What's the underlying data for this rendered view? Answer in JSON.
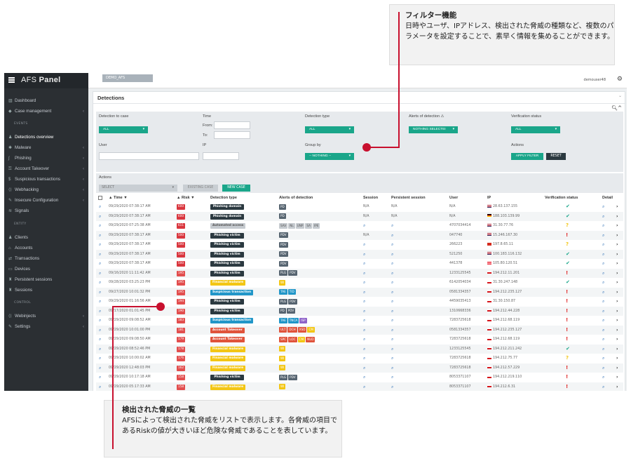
{
  "app": {
    "brand_light": "AFS ",
    "brand_bold": "Panel",
    "env": "DEMO_AFS",
    "user": "demouser48"
  },
  "sidebar": {
    "items": [
      {
        "label": "Dashboard",
        "icon": "bar-chart-icon",
        "chev": ""
      },
      {
        "label": "Case management",
        "icon": "tag-icon",
        "chev": "‹"
      },
      {
        "label": "Detections overview",
        "icon": "users-icon",
        "chev": ""
      },
      {
        "label": "Malware",
        "icon": "bug-icon",
        "chev": "‹"
      },
      {
        "label": "Phishing",
        "icon": "phishing-icon",
        "chev": "‹"
      },
      {
        "label": "Account Takeover",
        "icon": "key-icon",
        "chev": "‹"
      },
      {
        "label": "Suspicious transactions",
        "icon": "dollar-icon",
        "chev": "‹"
      },
      {
        "label": "Webhacking",
        "icon": "code-icon",
        "chev": "‹"
      },
      {
        "label": "Insecure Configuration",
        "icon": "wrench-icon",
        "chev": "‹"
      },
      {
        "label": "Signals",
        "icon": "signal-icon",
        "chev": ""
      },
      {
        "label": "Clients",
        "icon": "user-icon",
        "chev": ""
      },
      {
        "label": "Accounts",
        "icon": "bank-icon",
        "chev": ""
      },
      {
        "label": "Transactions",
        "icon": "exchange-icon",
        "chev": ""
      },
      {
        "label": "Devices",
        "icon": "monitor-icon",
        "chev": ""
      },
      {
        "label": "Persistent sessions",
        "icon": "person-icon",
        "chev": ""
      },
      {
        "label": "Sessions",
        "icon": "person-icon",
        "chev": ""
      },
      {
        "label": "Webinjects",
        "icon": "code-icon",
        "chev": "‹"
      },
      {
        "label": "Settings",
        "icon": "wrench-icon",
        "chev": "‹"
      }
    ],
    "sections": {
      "events": "EVENTS",
      "entity": "ENTITY",
      "control": "CONTROL"
    }
  },
  "content": {
    "title": "Detections"
  },
  "filters": {
    "detection_to_case": "Detection to case",
    "detection_to_case_value": "ALL",
    "time": "Time",
    "from": "From:",
    "to": "To:",
    "detection_type": "Detection type",
    "detection_type_value": "ALL",
    "alerts_of_detection": "Alerts of detection ⚠",
    "alerts_value": "NOTHING SELECTEI",
    "verification_status": "Verification status",
    "verification_value": "ALL",
    "user": "User",
    "ip": "IP",
    "group_by": "Group by",
    "group_by_value": "-- NOTHING --",
    "actions": "Actions",
    "apply_filter": "APPLY FILTER",
    "reset": "RESET"
  },
  "actions": {
    "title": "Actions",
    "select": "SELECT",
    "existing_case": "EXISTING CASE",
    "new_case": "NEW CASE"
  },
  "table": {
    "headers": {
      "time": "▲ Time ▼",
      "risk": "▲ Risk ▼",
      "type": "Detection type",
      "alerts": "Alerts of detection",
      "session": "Session",
      "psession": "Persistent session",
      "user": "User",
      "ip": "IP",
      "verif": "Verification status",
      "detail": "Detail"
    },
    "rows": [
      {
        "time": "09/29/2020 07:38:17 AM",
        "risk": "600",
        "type": "Phishing domain",
        "tc": "#2b3940",
        "alerts": [
          [
            "PD",
            "#566470"
          ]
        ],
        "session": "N/A",
        "ps": "N/A",
        "user": "N/A",
        "flag": "us",
        "ip": "28.63.137.155",
        "v": "ok"
      },
      {
        "time": "09/29/2020 07:38:17 AM",
        "risk": "600",
        "type": "Phishing domain",
        "tc": "#2b3940",
        "alerts": [
          [
            "PD",
            "#566470"
          ]
        ],
        "session": "N/A",
        "ps": "N/A",
        "user": "N/A",
        "flag": "de",
        "ip": "188.103.139.99",
        "v": "ok"
      },
      {
        "time": "09/29/2020 07:25:38 AM",
        "risk": "611",
        "type": "Automated access",
        "tc": "#c5cacf",
        "alerts": [
          [
            "SAV",
            "#c5cacf"
          ],
          [
            "NL",
            "#c5cacf"
          ],
          [
            "UNP",
            "#c5cacf"
          ],
          [
            "SA",
            "#c5cacf"
          ],
          [
            "IPE",
            "#c5cacf"
          ]
        ],
        "session": "",
        "ps": "",
        "user": "4707034414",
        "flag": "us",
        "ip": "31.30.77.76",
        "v": "q"
      },
      {
        "time": "09/29/2020 07:38:17 AM",
        "risk": "500",
        "type": "Phishing victim",
        "tc": "#2b3940",
        "alerts": [
          [
            "PDV",
            "#566470"
          ]
        ],
        "session": "N/A",
        "ps": "",
        "user": "047740",
        "flag": "us",
        "ip": "15.246.167.30",
        "v": "x"
      },
      {
        "time": "09/29/2020 07:38:17 AM",
        "risk": "500",
        "type": "Phishing victim",
        "tc": "#2b3940",
        "alerts": [
          [
            "PDV",
            "#566470"
          ]
        ],
        "session": "",
        "ps": "",
        "user": "266223",
        "flag": "ch",
        "ip": "197.8.65.11",
        "v": "q"
      },
      {
        "time": "09/29/2020 07:38:17 AM",
        "risk": "500",
        "type": "Phishing victim",
        "tc": "#2b3940",
        "alerts": [
          [
            "PDV",
            "#566470"
          ]
        ],
        "session": "",
        "ps": "",
        "user": "521250",
        "flag": "us",
        "ip": "100.183.116.132",
        "v": "ok"
      },
      {
        "time": "09/29/2020 07:38:17 AM",
        "risk": "500",
        "type": "Phishing victim",
        "tc": "#2b3940",
        "alerts": [
          [
            "PDV",
            "#566470"
          ]
        ],
        "session": "",
        "ps": "",
        "user": "441378",
        "flag": "at",
        "ip": "105.80.120.51",
        "v": "ok"
      },
      {
        "time": "09/16/2020 11:11:42 AM",
        "risk": "195",
        "type": "Phishing victim",
        "tc": "#2b3940",
        "alerts": [
          [
            "PLG",
            "#566470"
          ],
          [
            "PDV",
            "#566470"
          ]
        ],
        "session": "",
        "ps": "",
        "user": "1233125545",
        "flag": "cz",
        "ip": "194.212.11.201",
        "v": "x"
      },
      {
        "time": "09/28/2020 03:25:23 PM",
        "risk": "195",
        "type": "Financial malware",
        "tc": "#f3c614",
        "alerts": [
          [
            "WI",
            "#f3c614"
          ]
        ],
        "session": "",
        "ps": "",
        "user": "6142054034",
        "flag": "cz",
        "ip": "31.30.247.148",
        "v": "ok"
      },
      {
        "time": "09/27/2020 10:01:32 PM",
        "risk": "195",
        "type": "Suspicious transaction",
        "tc": "#2196c8",
        "alerts": [
          [
            "TAE",
            "#2196c8"
          ],
          [
            "TID",
            "#2196c8"
          ]
        ],
        "session": "",
        "ps": "",
        "user": "0581334357",
        "flag": "cz",
        "ip": "194.212.235.127",
        "v": "x"
      },
      {
        "time": "09/29/2020 01:16:56 AM",
        "risk": "194",
        "type": "Phishing victim",
        "tc": "#2b3940",
        "alerts": [
          [
            "PLG",
            "#566470"
          ],
          [
            "PDV",
            "#566470"
          ]
        ],
        "session": "",
        "ps": "",
        "user": "4459035413",
        "flag": "cz",
        "ip": "31.30.150.87",
        "v": "x"
      },
      {
        "time": "09/17/2020 01:01:45 PM",
        "risk": "190",
        "type": "Phishing victim",
        "tc": "#2b3940",
        "alerts": [
          [
            "PD",
            "#566470"
          ],
          [
            "PDV",
            "#566470"
          ]
        ],
        "session": "",
        "ps": "",
        "user": "1310668336",
        "flag": "cz",
        "ip": "194.212.44.228",
        "v": "x"
      },
      {
        "time": "09/29/2020 09:08:52 AM",
        "risk": "183",
        "type": "Suspicious transaction",
        "tc": "#2196c8",
        "alerts": [
          [
            "TAE",
            "#2196c8"
          ],
          [
            "TNCA",
            "#2196c8"
          ],
          [
            "ISP",
            "#8e63c9"
          ]
        ],
        "session": "",
        "ps": "",
        "user": "7283725618",
        "flag": "cz",
        "ip": "194.212.68.119",
        "v": "x"
      },
      {
        "time": "09/29/2020 10:01:00 PM",
        "risk": "181",
        "type": "Account Takeover",
        "tc": "#e0533b",
        "alerts": [
          [
            "ULT",
            "#e0533b"
          ],
          [
            "DCH",
            "#e0533b"
          ],
          [
            "XSD",
            "#e0533b"
          ],
          [
            "CM",
            "#f3c614"
          ]
        ],
        "session": "",
        "ps": "",
        "user": "0581334357",
        "flag": "cz",
        "ip": "194.212.235.127",
        "v": "x"
      },
      {
        "time": "09/29/2020 09:08:50 AM",
        "risk": "179",
        "type": "Account Takeover",
        "tc": "#e0533b",
        "alerts": [
          [
            "SPC",
            "#e0533b"
          ],
          [
            "LOC",
            "#e0533b"
          ],
          [
            "CM",
            "#f3c614"
          ],
          [
            "NUD",
            "#e0533b"
          ]
        ],
        "session": "",
        "ps": "",
        "user": "7283725618",
        "flag": "cz",
        "ip": "194.212.68.119",
        "v": "x"
      },
      {
        "time": "09/29/2020 08:52:46 PM",
        "risk": "178",
        "type": "Financial malware",
        "tc": "#f3c614",
        "alerts": [
          [
            "WI",
            "#f3c614"
          ]
        ],
        "session": "",
        "ps": "",
        "user": "1233125545",
        "flag": "cz",
        "ip": "194.212.211.242",
        "v": "ok"
      },
      {
        "time": "09/29/2020 10:00:02 AM",
        "risk": "176",
        "type": "Financial malware",
        "tc": "#f3c614",
        "alerts": [
          [
            "WI",
            "#f3c614"
          ]
        ],
        "session": "",
        "ps": "",
        "user": "7283725618",
        "flag": "cz",
        "ip": "194.212.75.77",
        "v": "q"
      },
      {
        "time": "09/29/2020 12:48:03 PM",
        "risk": "162",
        "type": "Financial malware",
        "tc": "#f3c614",
        "alerts": [
          [
            "WI",
            "#f3c614"
          ]
        ],
        "session": "",
        "ps": "",
        "user": "7283725618",
        "flag": "cz",
        "ip": "194.212.57.229",
        "v": "x"
      },
      {
        "time": "09/29/2020 10:17:18 AM",
        "risk": "158",
        "type": "Phishing victim",
        "tc": "#2b3940",
        "alerts": [
          [
            "PLG",
            "#566470"
          ],
          [
            "PDV",
            "#566470"
          ]
        ],
        "session": "",
        "ps": "",
        "user": "8053371107",
        "flag": "cz",
        "ip": "194.212.219.110",
        "v": "x"
      },
      {
        "time": "09/29/2020 05:17:33 AM",
        "risk": "158",
        "type": "Financial malware",
        "tc": "#f3c614",
        "alerts": [
          [
            "WI",
            "#f3c614"
          ]
        ],
        "session": "",
        "ps": "",
        "user": "8053371107",
        "flag": "cz",
        "ip": "194.212.6.31",
        "v": "x"
      }
    ]
  },
  "callouts": {
    "filter_title": "フィルター機能",
    "filter_body": "日時やユーザ、IPアドレス、検出された脅威の種類など、複数のパラメータを設定することで、素早く情報を集めることができます。",
    "list_title": "検出された脅威の一覧",
    "list_body": "AFSによって検出された脅威をリストで表示します。各脅威の項目であるRiskの値が大きいほど危険な脅威であることを表しています。"
  },
  "colors": {
    "accent": "#1aa68a",
    "risk_high": "#d9363e",
    "risk_mid": "#e24e4e",
    "callout_red": "#c8102e",
    "ok": "#1aa68a",
    "warn": "#f3c614",
    "bad": "#e02424"
  }
}
